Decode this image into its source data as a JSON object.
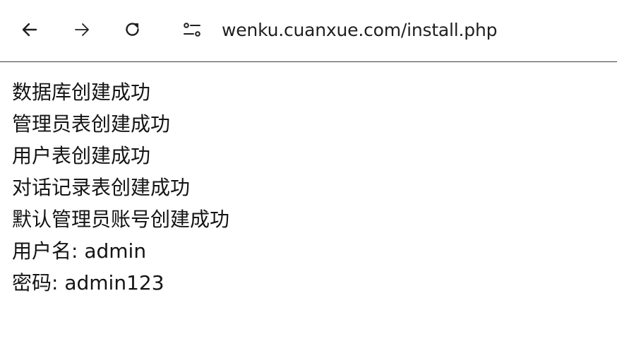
{
  "browser": {
    "url": "wenku.cuanxue.com/install.php",
    "icons": {
      "back": "arrow-left-icon",
      "forward": "arrow-right-icon",
      "reload": "reload-icon",
      "site_info": "tune-icon"
    }
  },
  "page": {
    "lines": [
      "数据库创建成功",
      "管理员表创建成功",
      "用户表创建成功",
      "对话记录表创建成功",
      "默认管理员账号创建成功",
      "用户名: admin",
      "密码: admin123"
    ]
  }
}
